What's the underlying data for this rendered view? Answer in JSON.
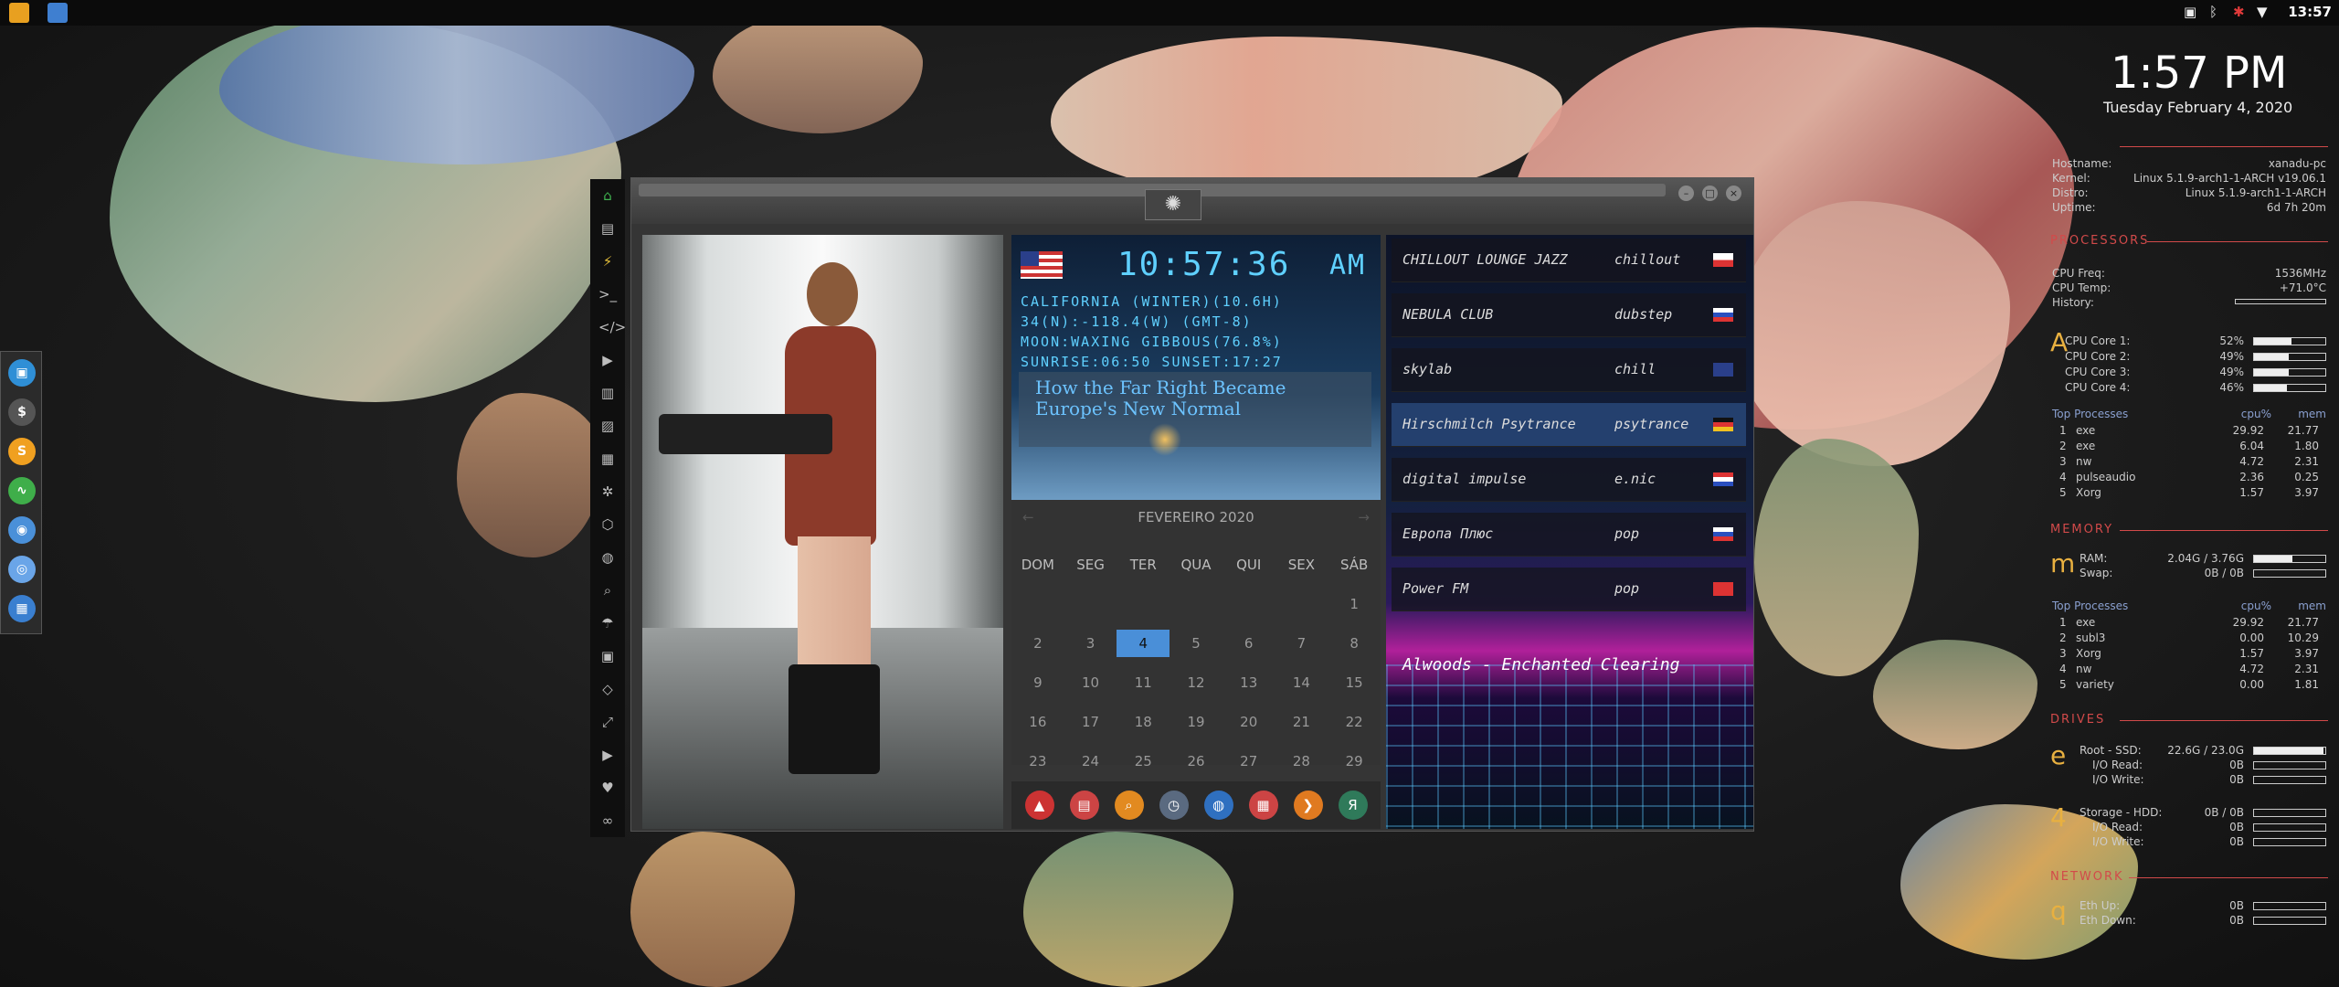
{
  "topbar": {
    "time": "13:57",
    "apps": [
      "sublime-text",
      "files"
    ],
    "tray_icons": [
      "screen-icon",
      "bluetooth-icon",
      "alert-icon",
      "wifi-icon"
    ]
  },
  "desktop": {
    "clock_time": "1:57 PM",
    "clock_date": "Tuesday February  4, 2020"
  },
  "dock": {
    "items": [
      {
        "name": "inbox",
        "glyph": "▣",
        "color": "#2f8fd6"
      },
      {
        "name": "terminal",
        "glyph": "$",
        "color": "#555555"
      },
      {
        "name": "sublime",
        "glyph": "S",
        "color": "#f0a020"
      },
      {
        "name": "activity",
        "glyph": "∿",
        "color": "#3fae4a"
      },
      {
        "name": "chrome",
        "glyph": "◉",
        "color": "#4a90d9"
      },
      {
        "name": "globe",
        "glyph": "◎",
        "color": "#6aa5e8"
      },
      {
        "name": "screenshot",
        "glyph": "▦",
        "color": "#3a7fd0"
      }
    ]
  },
  "sidebar": {
    "items": [
      {
        "name": "home",
        "glyph": "⌂",
        "color": "#3fb34f"
      },
      {
        "name": "document",
        "glyph": "▤"
      },
      {
        "name": "bolt",
        "glyph": "⚡",
        "color": "#e8c23a"
      },
      {
        "name": "terminal",
        "glyph": ">_"
      },
      {
        "name": "code",
        "glyph": "</>"
      },
      {
        "name": "play",
        "glyph": "▶"
      },
      {
        "name": "files",
        "glyph": "▥"
      },
      {
        "name": "image",
        "glyph": "▨"
      },
      {
        "name": "news",
        "glyph": "▦"
      },
      {
        "name": "settings",
        "glyph": "✲"
      },
      {
        "name": "hexagon",
        "glyph": "⬡"
      },
      {
        "name": "globe",
        "glyph": "◍"
      },
      {
        "name": "search",
        "glyph": "⌕"
      },
      {
        "name": "umbrella",
        "glyph": "☂"
      },
      {
        "name": "contact",
        "glyph": "▣"
      },
      {
        "name": "diamond-code",
        "glyph": "◇"
      },
      {
        "name": "expand",
        "glyph": "⤢"
      },
      {
        "name": "youtube",
        "glyph": "▶"
      },
      {
        "name": "heart",
        "glyph": "♥"
      },
      {
        "name": "link",
        "glyph": "∞"
      }
    ]
  },
  "world_clock": {
    "time": "10:57:36",
    "ampm": "AM",
    "lines": [
      "CALIFORNIA (WINTER)(10.6H)",
      "34(N):-118.4(W) (GMT-8)",
      "MOON:WAXING GIBBOUS(76.8%)",
      "SUNRISE:06:50 SUNSET:17:27"
    ],
    "headline": "How the Far Right Became Europe's New Normal"
  },
  "calendar": {
    "month": "FEVEREIRO 2020",
    "prev": "←",
    "next": "→",
    "weekdays": [
      "DOM",
      "SEG",
      "TER",
      "QUA",
      "QUI",
      "SEX",
      "SÁB"
    ],
    "weeks": [
      [
        "",
        "",
        "",
        "",
        "",
        "",
        "1"
      ],
      [
        "2",
        "3",
        "4",
        "5",
        "6",
        "7",
        "8"
      ],
      [
        "9",
        "10",
        "11",
        "12",
        "13",
        "14",
        "15"
      ],
      [
        "16",
        "17",
        "18",
        "19",
        "20",
        "21",
        "22"
      ],
      [
        "23",
        "24",
        "25",
        "26",
        "27",
        "28",
        "29"
      ]
    ],
    "current_day": "4"
  },
  "launcher": {
    "items": [
      {
        "name": "triangle-app",
        "glyph": "▲",
        "color": "#c33"
      },
      {
        "name": "notes",
        "glyph": "▤",
        "color": "#c44"
      },
      {
        "name": "search",
        "glyph": "⌕",
        "color": "#e28a20"
      },
      {
        "name": "clock",
        "glyph": "◷",
        "color": "#5a6a80"
      },
      {
        "name": "globe",
        "glyph": "◍",
        "color": "#2f70c0"
      },
      {
        "name": "calendar",
        "glyph": "▦",
        "color": "#c44"
      },
      {
        "name": "arrow",
        "glyph": "❯",
        "color": "#e07a20"
      },
      {
        "name": "yandex",
        "glyph": "Я",
        "color": "#2f7a5a"
      }
    ]
  },
  "radio": {
    "stations": [
      {
        "name": "CHILLOUT LOUNGE JAZZ",
        "genre": "chillout",
        "flag": "pl"
      },
      {
        "name": "NEBULA CLUB",
        "genre": "dubstep",
        "flag": "ru"
      },
      {
        "name": "skylab",
        "genre": "chill",
        "flag": "gb"
      },
      {
        "name": "Hirschmilch Psytrance",
        "genre": "psytrance",
        "flag": "de"
      },
      {
        "name": "digital impulse",
        "genre": "e.nic",
        "flag": "hr"
      },
      {
        "name": "Европа Плюс",
        "genre": "pop",
        "flag": "ru"
      },
      {
        "name": "Power FM",
        "genre": "pop",
        "flag": "tr"
      }
    ],
    "active_index": 3,
    "now_playing": "Alwoods - Enchanted Clearing"
  },
  "conky": {
    "system": [
      {
        "label": "Hostname:",
        "value": "xanadu-pc"
      },
      {
        "label": "Kernel:",
        "value": "Linux 5.1.9-arch1-1-ARCH v19.06.1"
      },
      {
        "label": "Distro:",
        "value": "Linux 5.1.9-arch1-1-ARCH"
      },
      {
        "label": "Uptime:",
        "value": "6d 7h 20m"
      }
    ],
    "processors_title": "PROCESSORS",
    "cpu_freq_label": "CPU Freq:",
    "cpu_freq": "1536MHz",
    "cpu_temp_label": "CPU Temp:",
    "cpu_temp": "+71.0°C",
    "history_label": "History:",
    "cpu_cores": [
      {
        "label": "CPU Core 1:",
        "value": "52%",
        "fill": 0.52
      },
      {
        "label": "CPU Core 2:",
        "value": "49%",
        "fill": 0.49
      },
      {
        "label": "CPU Core 3:",
        "value": "49%",
        "fill": 0.49
      },
      {
        "label": "CPU Core 4:",
        "value": "46%",
        "fill": 0.46
      }
    ],
    "top_cpu_title": "Top Processes",
    "col_cpu": "cpu%",
    "col_mem": "mem",
    "top_cpu": [
      {
        "rank": "1",
        "name": "exe",
        "cpu": "29.92",
        "mem": "21.77"
      },
      {
        "rank": "2",
        "name": "exe",
        "cpu": "6.04",
        "mem": "1.80"
      },
      {
        "rank": "3",
        "name": "nw",
        "cpu": "4.72",
        "mem": "2.31"
      },
      {
        "rank": "4",
        "name": "pulseaudio",
        "cpu": "2.36",
        "mem": "0.25"
      },
      {
        "rank": "5",
        "name": "Xorg",
        "cpu": "1.57",
        "mem": "3.97"
      }
    ],
    "memory_title": "MEMORY",
    "ram_label": "RAM:",
    "ram": "2.04G / 3.76G",
    "ram_fill": 0.54,
    "swap_label": "Swap:",
    "swap": "0B / 0B",
    "top_mem_title": "Top Processes",
    "top_mem": [
      {
        "rank": "1",
        "name": "exe",
        "cpu": "29.92",
        "mem": "21.77"
      },
      {
        "rank": "2",
        "name": "subl3",
        "cpu": "0.00",
        "mem": "10.29"
      },
      {
        "rank": "3",
        "name": "Xorg",
        "cpu": "1.57",
        "mem": "3.97"
      },
      {
        "rank": "4",
        "name": "nw",
        "cpu": "4.72",
        "mem": "2.31"
      },
      {
        "rank": "5",
        "name": "variety",
        "cpu": "0.00",
        "mem": "1.81"
      }
    ],
    "drives_title": "DRIVES",
    "root_label": "Root - SSD:",
    "root": "22.6G / 23.0G",
    "root_fill": 0.98,
    "io_read_label": "I/O Read:",
    "io_write_label": "I/O Write:",
    "io_read": "0B",
    "io_write": "0B",
    "storage_label": "Storage - HDD:",
    "storage": "0B / 0B",
    "st_read": "0B",
    "st_write": "0B",
    "network_title": "NETWORK",
    "eth_up_label": "Eth Up:",
    "eth_down_label": "Eth Down:",
    "eth_up": "0B",
    "eth_down": "0B",
    "glyphs": {
      "proc": "A",
      "mem": "m",
      "drive": "e",
      "storage": "4",
      "net": "q"
    }
  },
  "colors": {
    "accent_red": "#d24a4a",
    "calendar_today": "#4a8fd8",
    "lcd_cyan": "#5fd0ff"
  }
}
